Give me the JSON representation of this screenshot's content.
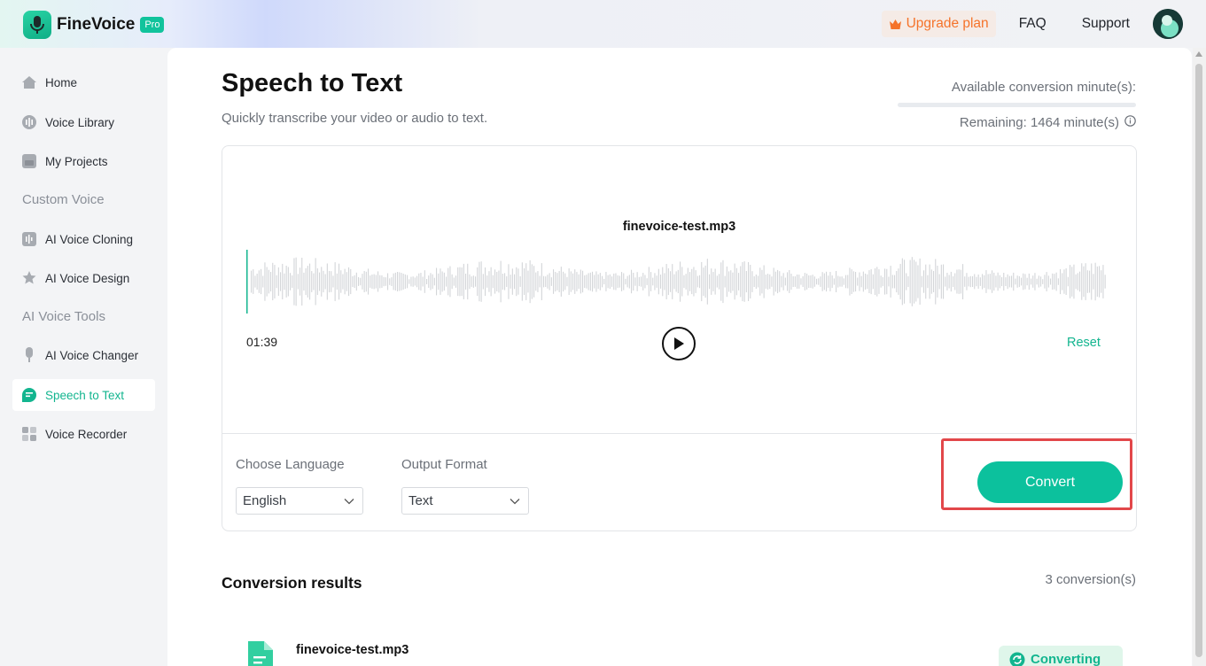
{
  "app": {
    "name": "FineVoice",
    "badge": "Pro"
  },
  "header": {
    "upgrade_label": "Upgrade plan",
    "faq_label": "FAQ",
    "support_label": "Support",
    "upgrade_icon": "crown-icon"
  },
  "sidebar": {
    "items": [
      {
        "label": "Home",
        "icon": "home-icon"
      },
      {
        "label": "Voice Library",
        "icon": "voice-library-icon"
      },
      {
        "label": "My Projects",
        "icon": "folder-icon"
      },
      {
        "label": "AI Voice Cloning",
        "icon": "voice-cloning-icon"
      },
      {
        "label": "AI Voice Design",
        "icon": "voice-design-icon"
      },
      {
        "label": "AI Voice Changer",
        "icon": "microphone-icon"
      },
      {
        "label": "Speech to Text",
        "icon": "speech-to-text-icon",
        "active": true
      },
      {
        "label": "Voice Recorder",
        "icon": "recorder-icon"
      }
    ],
    "sections": {
      "custom_voice": "Custom Voice",
      "ai_voice_tools": "AI Voice Tools"
    }
  },
  "page": {
    "title": "Speech to Text",
    "subtitle": "Quickly transcribe your video or audio to text.",
    "available_label": "Available conversion minute(s):",
    "remaining_label": "Remaining: 1464 minute(s)"
  },
  "player": {
    "file_name": "finevoice-test.mp3",
    "duration": "01:39",
    "reset_label": "Reset"
  },
  "options": {
    "language_label": "Choose Language",
    "language_value": "English",
    "format_label": "Output Format",
    "format_value": "Text",
    "convert_label": "Convert"
  },
  "results": {
    "title": "Conversion results",
    "count": "3 conversion(s)",
    "items": [
      {
        "file_name": "finevoice-test.mp3",
        "status": "Converting"
      }
    ]
  },
  "colors": {
    "accent": "#0cc19d",
    "upgrade": "#f5732a",
    "highlight": "#e2474a"
  }
}
